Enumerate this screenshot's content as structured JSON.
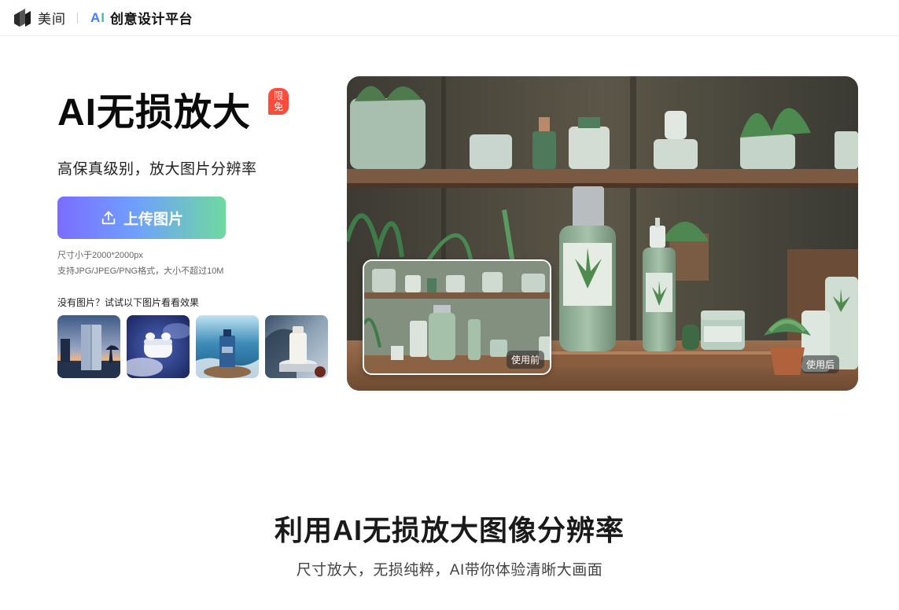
{
  "nav": {
    "brand_name": "美间",
    "ai_mark_a": "A",
    "ai_mark_i": "I",
    "product_name": "创意设计平台"
  },
  "hero": {
    "title": "AI无损放大",
    "badge": "限免",
    "subtitle": "高保真级别，放大图片分辨率",
    "upload_label": "上传图片",
    "hint_size": "尺寸小于2000*2000px",
    "hint_format": "支持JPG/JPEG/PNG格式，大小不超过10M",
    "sample_label": "没有图片？试试以下图片看看效果",
    "before_label": "使用前",
    "after_label": "使用后"
  },
  "section": {
    "title": "利用AI无损放大图像分辨率",
    "subtitle": "尺寸放大，无损纯粹，AI带你体验清晰大画面"
  },
  "colors": {
    "badge": "#ff4b3b",
    "upload_gradient": [
      "#7b6dff",
      "#6f9eff",
      "#6fd9a0"
    ],
    "ai_a": "#4a7cff",
    "ai_i": "#37c6a6"
  },
  "icons": {
    "logo": "meijian-logo-icon",
    "upload": "upload-icon"
  }
}
